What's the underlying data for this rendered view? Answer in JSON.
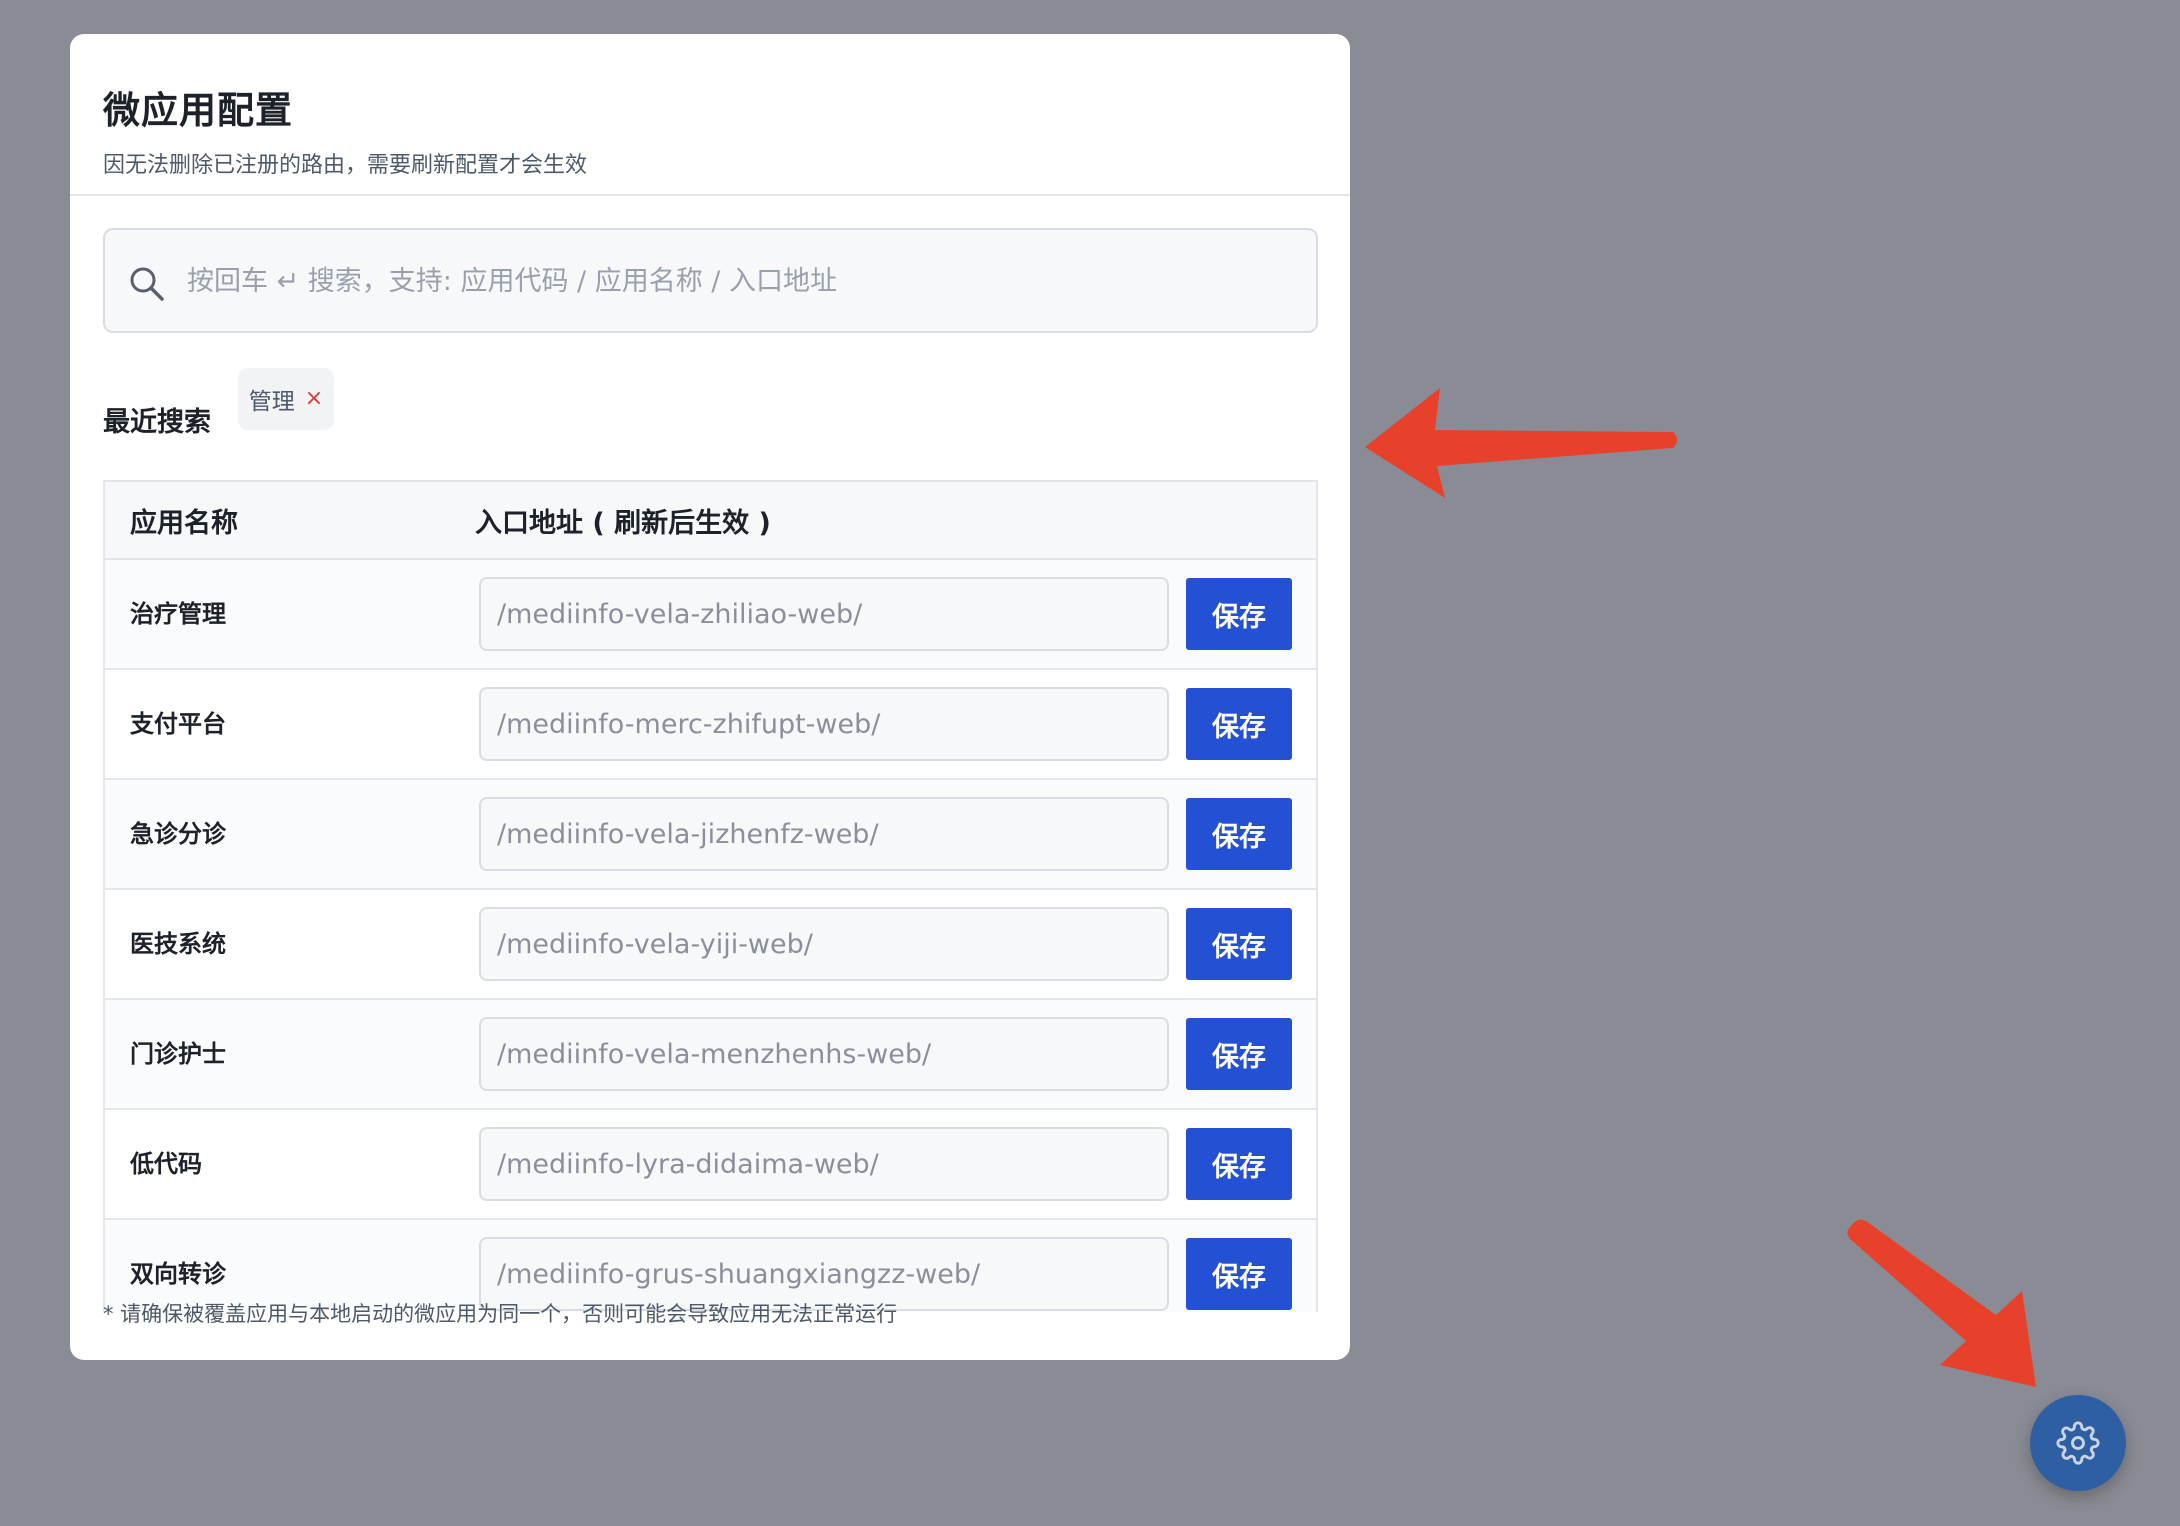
{
  "panel": {
    "title": "微应用配置",
    "subtitle": "因无法删除已注册的路由，需要刷新配置才会生效"
  },
  "search": {
    "icon": "search-icon",
    "placeholder": "按回车 ↵ 搜索，支持: 应用代码 / 应用名称 / 入口地址"
  },
  "recent": {
    "label": "最近搜索",
    "tags": [
      {
        "text": "管理",
        "close": "×"
      }
    ]
  },
  "table": {
    "headers": {
      "name": "应用名称",
      "url": "入口地址 ( 刷新后生效 )"
    },
    "save_label": "保存",
    "rows": [
      {
        "name": "治疗管理",
        "url_placeholder": "/mediinfo-vela-zhiliao-web/"
      },
      {
        "name": "支付平台",
        "url_placeholder": "/mediinfo-merc-zhifupt-web/"
      },
      {
        "name": "急诊分诊",
        "url_placeholder": "/mediinfo-vela-jizhenfz-web/"
      },
      {
        "name": "医技系统",
        "url_placeholder": "/mediinfo-vela-yiji-web/"
      },
      {
        "name": "门诊护士",
        "url_placeholder": "/mediinfo-vela-menzhenhs-web/"
      },
      {
        "name": "低代码",
        "url_placeholder": "/mediinfo-lyra-didaima-web/"
      },
      {
        "name": "双向转诊",
        "url_placeholder": "/mediinfo-grus-shuangxiangzz-web/"
      }
    ]
  },
  "footnote": "* 请确保被覆盖应用与本地启动的微应用为同一个，否则可能会导致应用无法正常运行",
  "fab": {
    "icon": "gear-icon"
  },
  "colors": {
    "overlay": "#8a8c95",
    "primary": "#2450d3",
    "fab": "#2f5fa3",
    "annotation": "#e8412b",
    "tag_close": "#e53935"
  }
}
